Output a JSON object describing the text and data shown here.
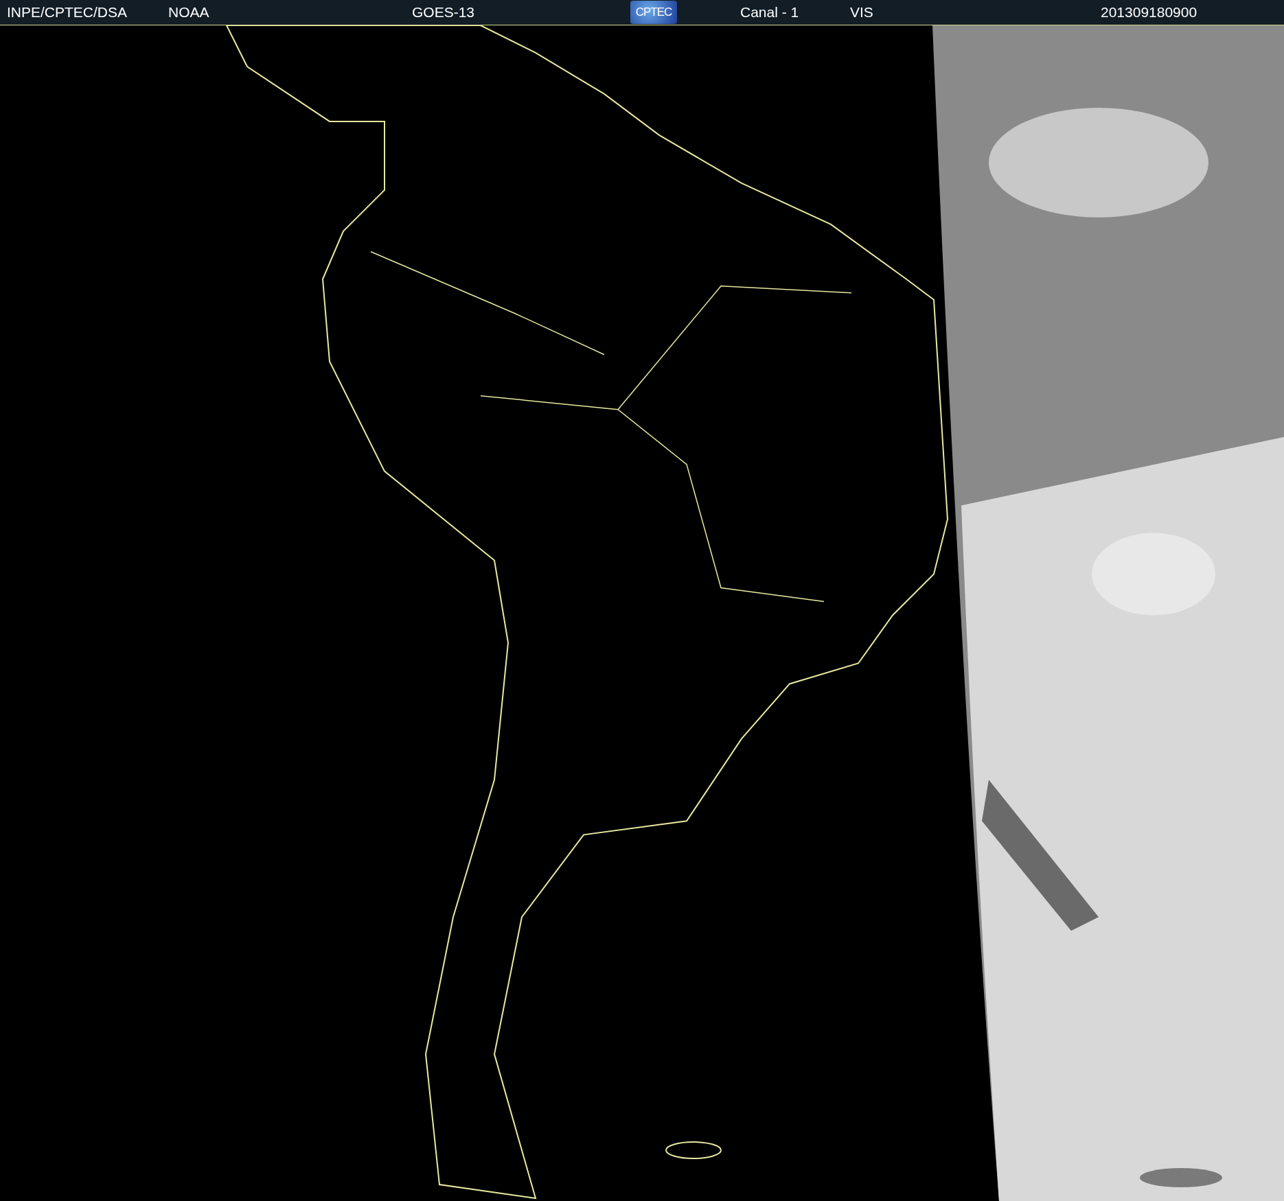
{
  "header": {
    "labels": [
      "INPE/CPTEC/DSA",
      "NOAA",
      "GOES-13"
    ],
    "logo": "CPTEC",
    "channel": "Canal - 1",
    "band": "VIS",
    "timestamp": "201309180900"
  }
}
